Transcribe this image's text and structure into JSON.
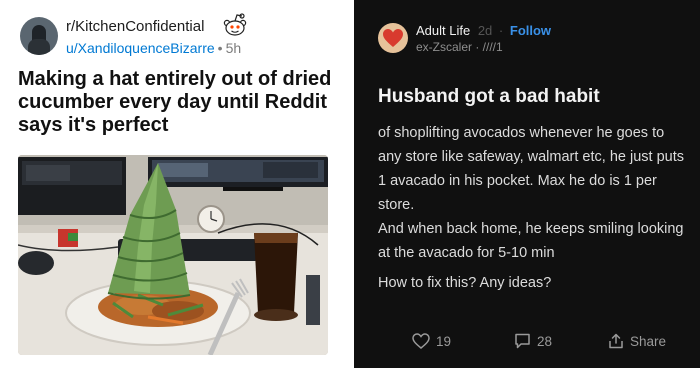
{
  "reddit": {
    "subreddit": "r/KitchenConfidential",
    "username": "u/XandiloquenceBizarre",
    "separator": "•",
    "age": "5h",
    "title": "Making a hat entirely out of dried cucumber every day until Reddit says it's perfect",
    "icons": [
      "reddit-snoo-icon"
    ]
  },
  "threads": {
    "account": "Adult Life",
    "time": "2d",
    "separator": "·",
    "follow": "Follow",
    "handle": "ex-Zscaler · ////1",
    "title": "Husband got a bad habit",
    "body": [
      "of shoplifting avocados whenever he goes to any store like safeway, walmart etc, he just puts 1 avacado in his pocket. Max he do is 1 per store.",
      "And when back home, he keeps smiling looking at the avacado for 5-10 min"
    ],
    "question": "How to fix this? Any ideas?",
    "actions": {
      "likes": "19",
      "comments": "28",
      "share": "Share"
    },
    "colors": {
      "background": "#101010",
      "follow": "#3a91e8"
    },
    "icons": [
      "heart-icon",
      "comment-icon",
      "share-icon"
    ]
  }
}
